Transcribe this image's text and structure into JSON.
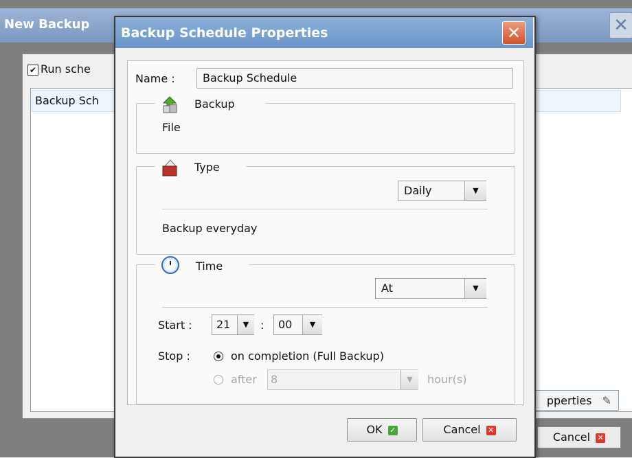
{
  "background_window": {
    "title": "New Backup",
    "run_schedule_label": "Run sche",
    "list_item": "Backup Sch",
    "properties_button": "pperties",
    "cancel_button": "Cancel"
  },
  "dialog": {
    "title": "Backup Schedule Properties",
    "name_label": "Name :",
    "name_value": "Backup Schedule",
    "backup_section": {
      "legend": "Backup",
      "value": "File",
      "icon": "backup-icon"
    },
    "type_section": {
      "legend": "Type",
      "select_value": "Daily",
      "description": "Backup everyday",
      "icon": "type-icon"
    },
    "time_section": {
      "legend": "Time",
      "icon": "clock-icon",
      "select_value": "At",
      "start_label": "Start :",
      "start_hour": "21",
      "time_separator": ":",
      "start_minute": "00",
      "stop_label": "Stop :",
      "stop_option_completion": "on completion (Full Backup)",
      "stop_option_after": "after",
      "after_value": "8",
      "hours_unit": "hour(s)"
    },
    "ok_button": "OK",
    "cancel_button": "Cancel"
  },
  "colors": {
    "title_blue": "#7a9fcf",
    "close_orange": "#e06a45",
    "ok_green": "#48a53a",
    "cancel_red": "#d93a2b"
  }
}
